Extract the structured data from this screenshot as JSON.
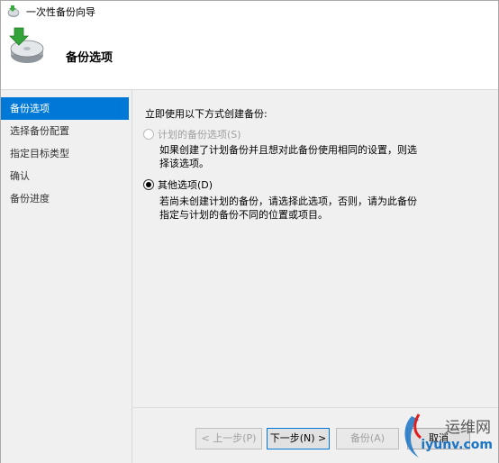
{
  "window": {
    "title": "一次性备份向导"
  },
  "header": {
    "title": "备份选项"
  },
  "sidebar": {
    "items": [
      {
        "label": "备份选项",
        "active": true
      },
      {
        "label": "选择备份配置",
        "active": false
      },
      {
        "label": "指定目标类型",
        "active": false
      },
      {
        "label": "确认",
        "active": false
      },
      {
        "label": "备份进度",
        "active": false
      }
    ]
  },
  "main": {
    "intro": "立即使用以下方式创建备份:",
    "options": [
      {
        "label": "计划的备份选项(S)",
        "selected": false,
        "disabled": true,
        "description": "如果创建了计划备份并且想对此备份使用相同的设置，则选择该选项。"
      },
      {
        "label": "其他选项(D)",
        "selected": true,
        "disabled": false,
        "description": "若尚未创建计划的备份，请选择此选项，否则，请为此备份指定与计划的备份不同的位置或项目。"
      }
    ]
  },
  "footer": {
    "prev_label": "< 上一步(P)",
    "next_label": "下一步(N) >",
    "backup_label": "备份(A)",
    "cancel_label": "取消"
  },
  "watermark": {
    "line1": "运维网",
    "line2": "iyunv.com"
  },
  "colors": {
    "accent": "#0078d7",
    "sidebar_bg": "#f0f0f0",
    "content_bg": "#f0f0f0",
    "disabled_text": "#a0a0a0"
  },
  "icons": {
    "title_icon": "backup-wizard-icon",
    "header_icon": "backup-disc-icon"
  }
}
